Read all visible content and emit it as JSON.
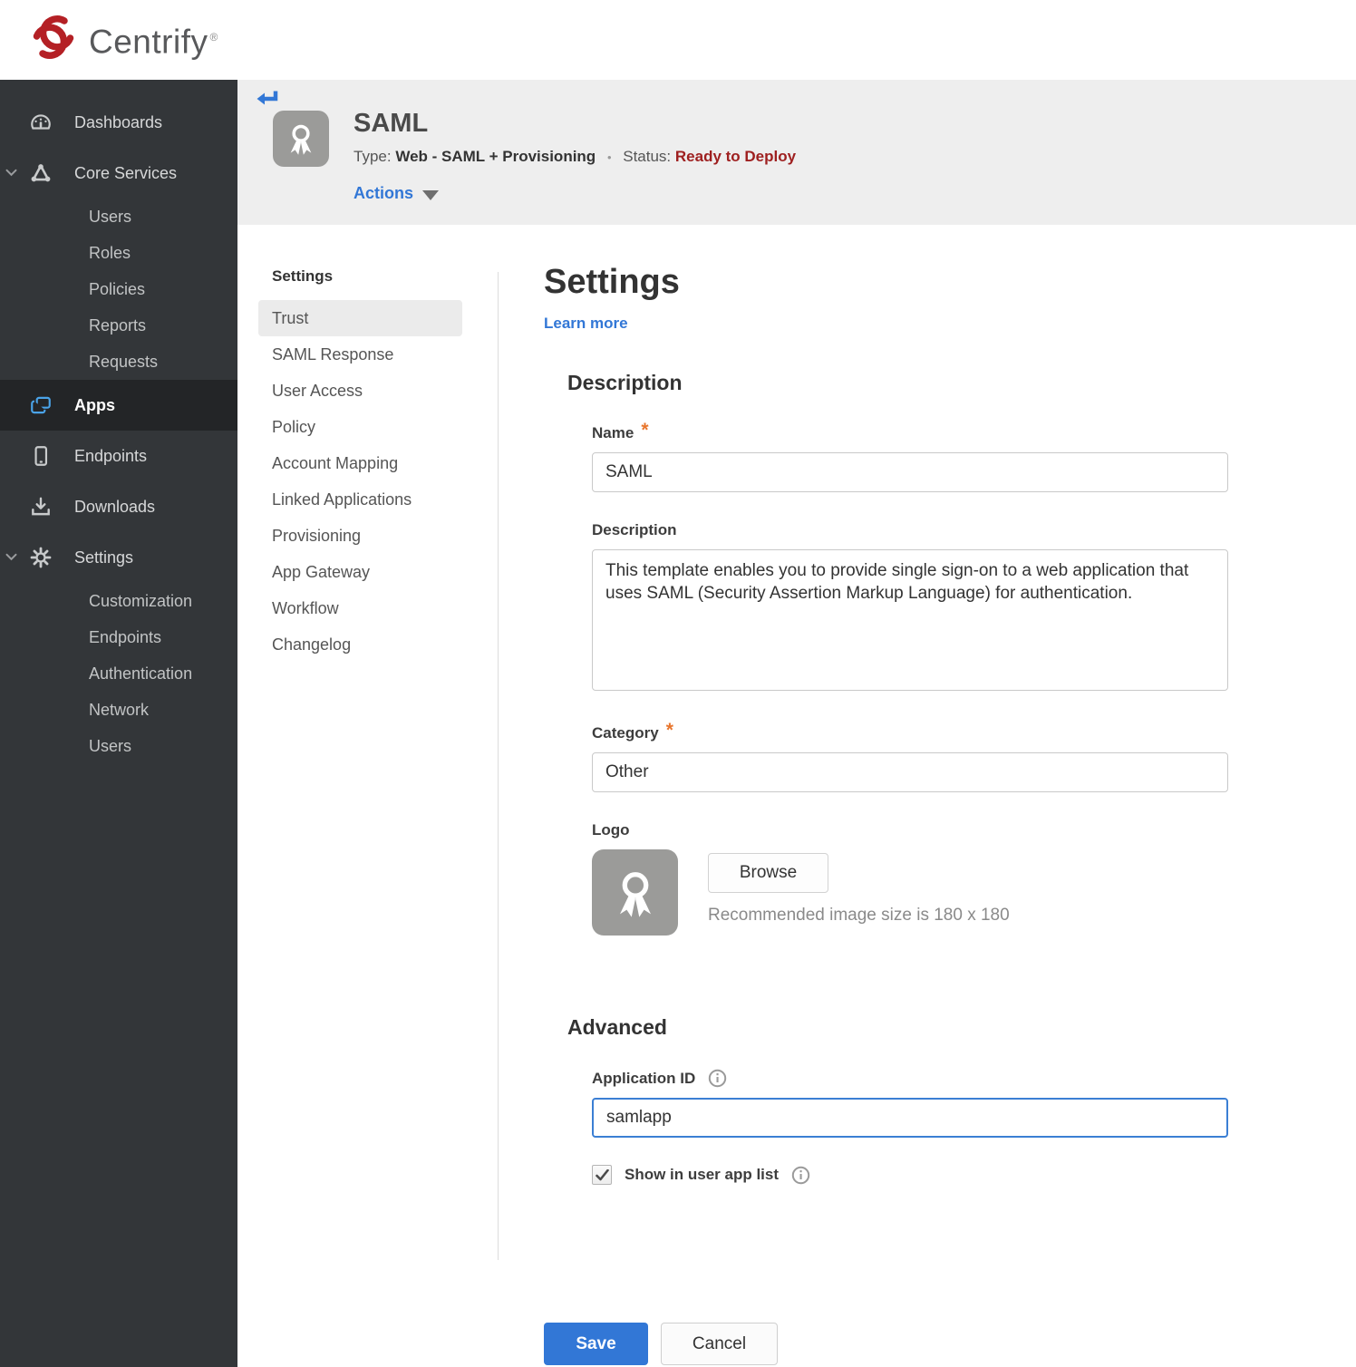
{
  "brand": {
    "name": "Centrify",
    "registered": "®"
  },
  "colors": {
    "accent_blue": "#3277d6",
    "status_red": "#9e1f1f",
    "required_orange": "#e8762d",
    "sidebar_bg": "#333639",
    "sidebar_selected_bg": "#232527",
    "sidebar_icon_selected": "#4aa3e8",
    "app_header_bg": "#eeeeee",
    "brand_swirl_red": "#b42025"
  },
  "sidebar": {
    "items": [
      {
        "label": "Dashboards"
      },
      {
        "label": "Core Services"
      },
      {
        "label": "Users"
      },
      {
        "label": "Roles"
      },
      {
        "label": "Policies"
      },
      {
        "label": "Reports"
      },
      {
        "label": "Requests"
      },
      {
        "label": "Apps"
      },
      {
        "label": "Endpoints"
      },
      {
        "label": "Downloads"
      },
      {
        "label": "Settings"
      },
      {
        "label": "Customization"
      },
      {
        "label": "Endpoints"
      },
      {
        "label": "Authentication"
      },
      {
        "label": "Network"
      },
      {
        "label": "Users"
      }
    ]
  },
  "app_header": {
    "title": "SAML",
    "type_label": "Type:",
    "type_value": "Web - SAML + Provisioning",
    "separator": "•",
    "status_label": "Status:",
    "status_value": "Ready to Deploy",
    "actions_label": "Actions"
  },
  "subnav": {
    "title": "Settings",
    "items": [
      {
        "label": "Trust",
        "selected": true
      },
      {
        "label": "SAML Response"
      },
      {
        "label": "User Access"
      },
      {
        "label": "Policy"
      },
      {
        "label": "Account Mapping"
      },
      {
        "label": "Linked Applications"
      },
      {
        "label": "Provisioning"
      },
      {
        "label": "App Gateway"
      },
      {
        "label": "Workflow"
      },
      {
        "label": "Changelog"
      }
    ]
  },
  "main": {
    "title": "Settings",
    "learn_more": "Learn more",
    "description_section": {
      "title": "Description",
      "name_label": "Name",
      "name_required": "*",
      "name_value": "SAML",
      "description_label": "Description",
      "description_value": "This template enables you to provide single sign-on to a web application that uses SAML (Security Assertion Markup Language) for authentication.",
      "category_label": "Category",
      "category_required": "*",
      "category_value": "Other",
      "logo_label": "Logo",
      "browse_label": "Browse",
      "logo_hint": "Recommended image size is 180 x 180"
    },
    "advanced_section": {
      "title": "Advanced",
      "app_id_label": "Application ID",
      "app_id_value": "samlapp",
      "show_label": "Show in user app list",
      "show_checked": true
    },
    "footer": {
      "save_label": "Save",
      "cancel_label": "Cancel"
    }
  }
}
